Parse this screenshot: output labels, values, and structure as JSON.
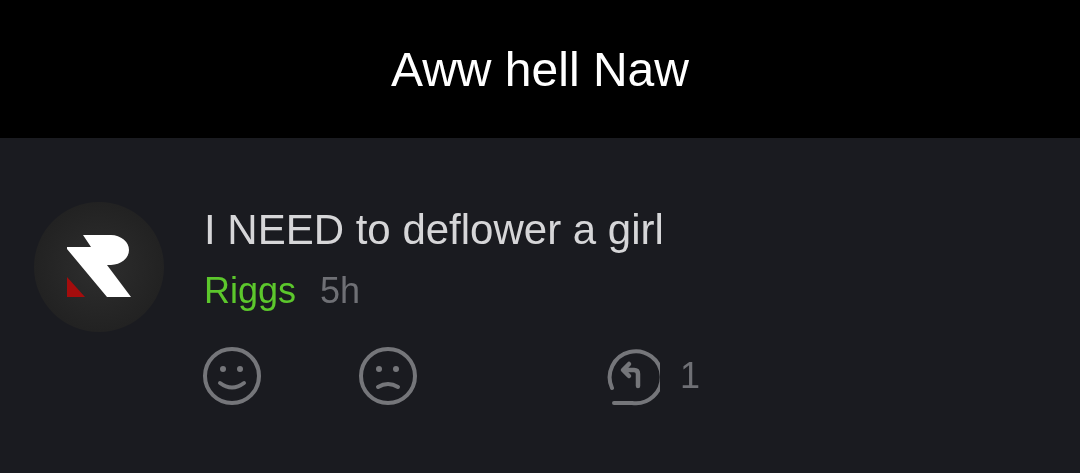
{
  "caption": "Aww hell Naw",
  "comment": {
    "text": "I NEED to deflower a girl",
    "author": "Riggs",
    "time": "5h",
    "reply_count": "1"
  }
}
